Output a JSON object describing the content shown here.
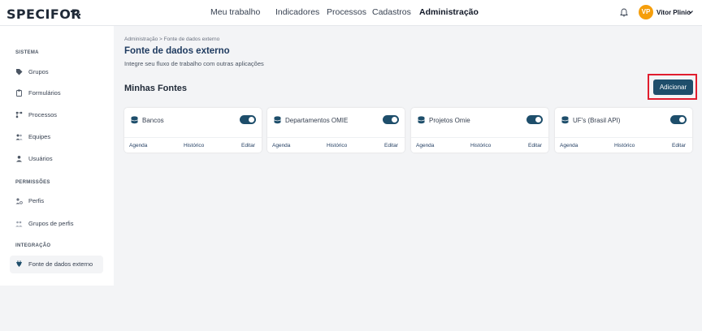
{
  "topbar": {
    "logo": "SPECIFOR",
    "nav": [
      "Meu trabalho",
      "Indicadores",
      "Processos",
      "Cadastros",
      "Administração"
    ],
    "active_nav": "Administração",
    "user_initials": "VP",
    "user_name": "Vitor Plinio",
    "avatar_color": "#f59e0b"
  },
  "sidebar": {
    "sections": [
      {
        "title": "SISTEMA",
        "items": [
          {
            "label": "Grupos",
            "icon": "tag-icon"
          },
          {
            "label": "Formulários",
            "icon": "clipboard-icon"
          },
          {
            "label": "Processos",
            "icon": "process-icon"
          },
          {
            "label": "Equipes",
            "icon": "team-icon"
          },
          {
            "label": "Usuários",
            "icon": "user-icon"
          }
        ]
      },
      {
        "title": "PERMISSÕES",
        "items": [
          {
            "label": "Perfis",
            "icon": "profile-icon"
          },
          {
            "label": "Grupos de perfis",
            "icon": "profile-group-icon"
          }
        ]
      },
      {
        "title": "INTEGRAÇÃO",
        "items": [
          {
            "label": "Fonte de dados externo",
            "icon": "plug-icon",
            "active": true
          }
        ]
      }
    ]
  },
  "main": {
    "breadcrumb": "Administração  >  Fonte de dados externo",
    "title": "Fonte de dados externo",
    "subtitle": "Integre seu fluxo de trabalho com outras aplicações",
    "section_title": "Minhas Fontes",
    "add_button": "Adicionar",
    "accent_color": "#1e4e6b",
    "cards": [
      {
        "name": "Bancos",
        "enabled": true,
        "links": [
          "Agenda",
          "Histórico",
          "Editar"
        ]
      },
      {
        "name": "Departamentos OMIE",
        "enabled": true,
        "links": [
          "Agenda",
          "Histórico",
          "Editar"
        ]
      },
      {
        "name": "Projetos Omie",
        "enabled": true,
        "links": [
          "Agenda",
          "Histórico",
          "Editar"
        ]
      },
      {
        "name": "UF's (Brasil API)",
        "enabled": true,
        "links": [
          "Agenda",
          "Histórico",
          "Editar"
        ]
      }
    ]
  }
}
